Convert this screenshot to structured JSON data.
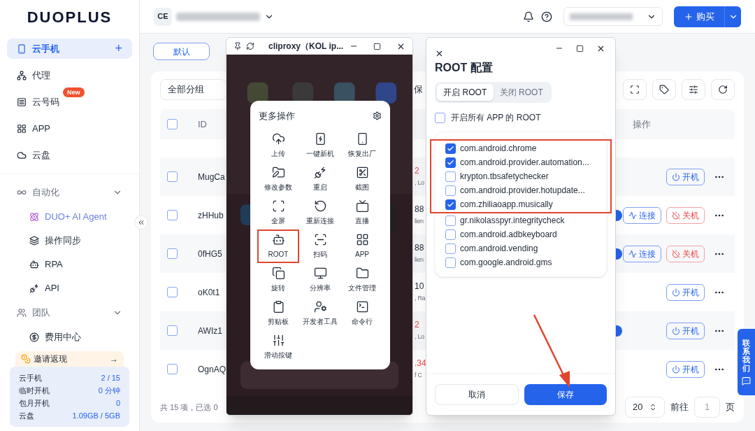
{
  "brand": {
    "logo": "DUOPLUS"
  },
  "sidebar": {
    "nav": [
      {
        "label": "云手机",
        "selected": true,
        "add": "+"
      },
      {
        "label": "代理",
        "selected": false
      },
      {
        "label": "云号码",
        "selected": false,
        "badge": "New"
      },
      {
        "label": "APP",
        "selected": false
      },
      {
        "label": "云盘",
        "selected": false
      }
    ],
    "sections": [
      {
        "title": "自动化",
        "expanded": true,
        "children": [
          {
            "label": "DUO+ AI Agent",
            "kind": "agent"
          },
          {
            "label": "操作同步",
            "kind": "plain"
          },
          {
            "label": "RPA",
            "kind": "plain"
          },
          {
            "label": "API",
            "kind": "plain"
          }
        ]
      },
      {
        "title": "团队",
        "expanded": true,
        "children": [
          {
            "label": "费用中心",
            "kind": "plain"
          }
        ]
      }
    ],
    "invite": {
      "label": "邀请返现",
      "arrow": "→"
    },
    "usage": [
      {
        "label": "云手机",
        "value": "2 / 15"
      },
      {
        "label": "临时开机",
        "value": "0 分钟"
      },
      {
        "label": "包月开机",
        "value": "0"
      },
      {
        "label": "云盘",
        "value": "1.09GB / 5GB"
      }
    ]
  },
  "topbar": {
    "avatar": "CE",
    "buy": "购买"
  },
  "view_tabs": [
    {
      "label": "默认",
      "selected": true
    }
  ],
  "filter": {
    "group": "全部分组",
    "cut_text": "保"
  },
  "table": {
    "columns": [
      "ID",
      "操作"
    ],
    "select_all_checked": false,
    "rows": [
      {
        "checked": false,
        "id": "MugCa",
        "column_3": "2",
        "alert": true,
        "column_3_sub": ", Lo",
        "badge": false,
        "actions": [
          {
            "kind": "power_on",
            "label": "开机"
          }
        ]
      },
      {
        "checked": false,
        "id": "zHHub",
        "column_3": "88",
        "alert": false,
        "column_3_sub": "lien",
        "badge": true,
        "actions": [
          {
            "kind": "connect",
            "label": "连接"
          },
          {
            "kind": "power_off",
            "label": "关机"
          }
        ]
      },
      {
        "checked": false,
        "id": "0fHG5",
        "column_3": "88",
        "alert": false,
        "column_3_sub": "lien",
        "badge": true,
        "actions": [
          {
            "kind": "connect",
            "label": "连接"
          },
          {
            "kind": "power_off",
            "label": "关机"
          }
        ]
      },
      {
        "checked": false,
        "id": "oK0t1",
        "column_3": "10",
        "alert": false,
        "column_3_sub": ", Ra",
        "badge": false,
        "actions": [
          {
            "kind": "power_on",
            "label": "开机"
          }
        ]
      },
      {
        "checked": false,
        "id": "AWIz1",
        "column_3": "2",
        "alert": true,
        "column_3_sub": ", Lo",
        "badge": true,
        "actions": [
          {
            "kind": "power_on",
            "label": "开机"
          }
        ]
      },
      {
        "checked": false,
        "id": "OgnAQ",
        "column_3": ".34",
        "alert": true,
        "column_3_sub": "f C",
        "badge": false,
        "actions": [
          {
            "kind": "power_on",
            "label": "开机"
          }
        ]
      }
    ]
  },
  "footer": {
    "summary": "共 15 项，已选 0",
    "page_size": "20",
    "goto": "前往",
    "page": "1",
    "page_suffix": "页"
  },
  "phone_window": {
    "title": "cliproxy（KOL ip...",
    "menu": {
      "title": "更多操作",
      "items": [
        {
          "label": "上传",
          "highlighted": false
        },
        {
          "label": "一键新机",
          "highlighted": false
        },
        {
          "label": "恢复出厂",
          "highlighted": false
        },
        {
          "label": "修改参数",
          "highlighted": false
        },
        {
          "label": "重启",
          "highlighted": false
        },
        {
          "label": "截图",
          "highlighted": false
        },
        {
          "label": "全屏",
          "highlighted": false
        },
        {
          "label": "重新连接",
          "highlighted": false
        },
        {
          "label": "直播",
          "highlighted": false
        },
        {
          "label": "ROOT",
          "highlighted": true
        },
        {
          "label": "扫码",
          "highlighted": false
        },
        {
          "label": "APP",
          "highlighted": false
        },
        {
          "label": "旋转",
          "highlighted": false
        },
        {
          "label": "分辨率",
          "highlighted": false
        },
        {
          "label": "文件管理",
          "highlighted": false
        },
        {
          "label": "剪贴板",
          "highlighted": false
        },
        {
          "label": "开发者工具",
          "highlighted": false
        },
        {
          "label": "命令行",
          "highlighted": false
        },
        {
          "label": "滑动按键",
          "highlighted": false
        }
      ]
    }
  },
  "root_dialog": {
    "title": "ROOT 配置",
    "modes": [
      {
        "label": "开启 ROOT",
        "selected": true
      },
      {
        "label": "关闭 ROOT",
        "selected": false
      }
    ],
    "all_apps": {
      "label": "开启所有 APP 的 ROOT",
      "checked": false
    },
    "app_groups": [
      {
        "highlighted": true,
        "apps": [
          {
            "name": "com.android.chrome",
            "checked": true
          },
          {
            "name": "com.android.provider.automation...",
            "checked": true
          },
          {
            "name": "krypton.tbsafetychecker",
            "checked": false
          },
          {
            "name": "com.android.provider.hotupdate...",
            "checked": false
          },
          {
            "name": "com.zhiliaoapp.musically",
            "checked": true
          }
        ]
      },
      {
        "highlighted": false,
        "apps": [
          {
            "name": "gr.nikolasspyr.integritycheck",
            "checked": false
          },
          {
            "name": "com.android.adbkeyboard",
            "checked": false
          },
          {
            "name": "com.android.vending",
            "checked": false
          },
          {
            "name": "com.google.android.gms",
            "checked": false
          }
        ]
      }
    ],
    "cancel": "取消",
    "save": "保存"
  },
  "contact": {
    "label": "联系我们"
  }
}
